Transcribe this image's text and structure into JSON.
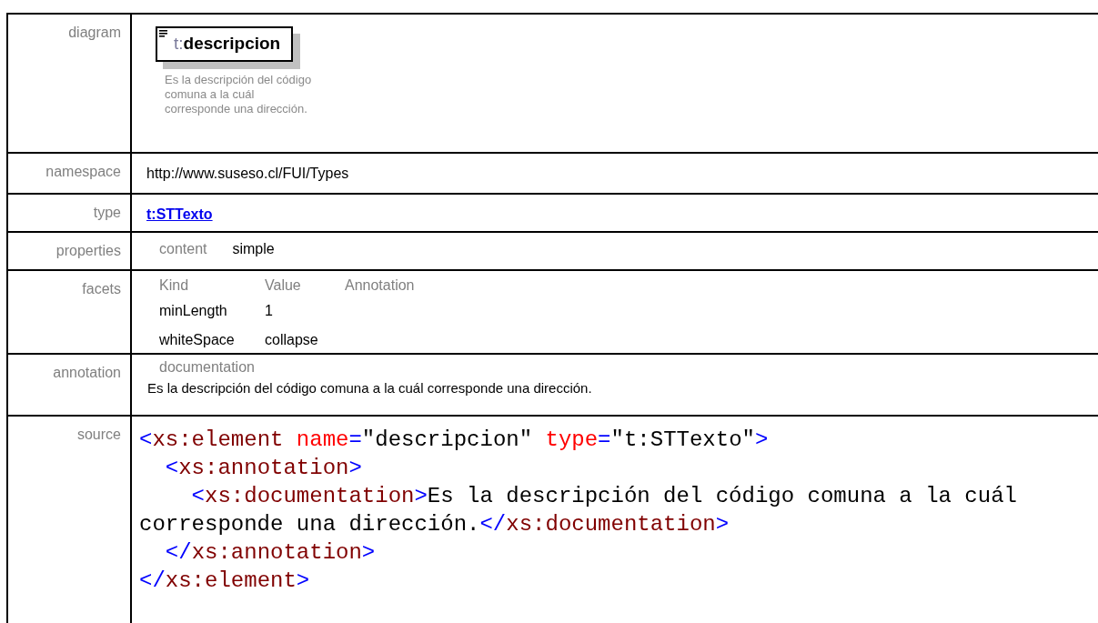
{
  "rows": [
    {
      "kind": "diagram",
      "label": "diagram",
      "element": {
        "prefix": "t:",
        "name": "descripcion"
      },
      "documentation": [
        "Es la descripción del código",
        "comuna a la cuál",
        "corresponde una dirección."
      ]
    },
    {
      "kind": "text",
      "label": "namespace",
      "value": "http://www.suseso.cl/FUI/Types"
    },
    {
      "kind": "link",
      "label": "type",
      "value": "t:STTexto"
    },
    {
      "kind": "properties",
      "label": "properties",
      "items": [
        {
          "name": "content",
          "value": "simple"
        }
      ]
    },
    {
      "kind": "facets",
      "label": "facets",
      "columns": [
        "Kind",
        "Value",
        "Annotation"
      ],
      "items": [
        [
          "minLength",
          "1"
        ],
        [
          "whiteSpace",
          "collapse"
        ]
      ]
    },
    {
      "kind": "annotation",
      "label": "annotation",
      "heading": "documentation",
      "text": "Es la descripción del código comuna a la cuál corresponde una dirección."
    },
    {
      "kind": "source",
      "label": "source",
      "lines": [
        [
          {
            "kind": "punct",
            "text": "<"
          },
          {
            "kind": "tag",
            "text": "xs:element"
          },
          {
            "kind": "attr",
            "text": " name"
          },
          {
            "kind": "punct",
            "text": "="
          },
          {
            "kind": "value",
            "text": "\"descripcion\""
          },
          {
            "kind": "attr",
            "text": " type"
          },
          {
            "kind": "punct",
            "text": "="
          },
          {
            "kind": "value",
            "text": "\"t:STTexto\""
          },
          {
            "kind": "punct",
            "text": ">"
          }
        ],
        [
          {
            "kind": "punct",
            "text": "  <"
          },
          {
            "kind": "tag",
            "text": "xs:annotation"
          },
          {
            "kind": "punct",
            "text": ">"
          }
        ],
        [
          {
            "kind": "punct",
            "text": "    <"
          },
          {
            "kind": "tag",
            "text": "xs:documentation"
          },
          {
            "kind": "punct",
            "text": ">"
          },
          {
            "kind": "text",
            "text": "Es la descripción del código comuna a la cuál corresponde una dirección."
          },
          {
            "kind": "punct",
            "text": "</"
          },
          {
            "kind": "tag",
            "text": "xs:documentation"
          },
          {
            "kind": "punct",
            "text": ">"
          }
        ],
        [
          {
            "kind": "punct",
            "text": "  </"
          },
          {
            "kind": "tag",
            "text": "xs:annotation"
          },
          {
            "kind": "punct",
            "text": ">"
          }
        ],
        [
          {
            "kind": "punct",
            "text": "</"
          },
          {
            "kind": "tag",
            "text": "xs:element"
          },
          {
            "kind": "punct",
            "text": ">"
          }
        ]
      ]
    }
  ]
}
